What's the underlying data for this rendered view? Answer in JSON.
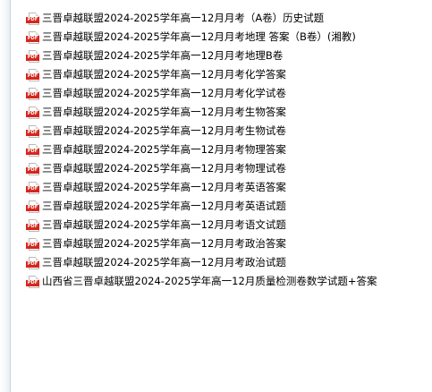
{
  "icons": {
    "file_icon": "pdf-file-icon",
    "file_icon_label": "PDF",
    "accent_color": "#d8261c"
  },
  "files": [
    "三晋卓越联盟2024-2025学年高一12月月考（A卷）历史试题",
    "三晋卓越联盟2024-2025学年高一12月月考地理 答案（B卷）(湘教)",
    "三晋卓越联盟2024-2025学年高一12月月考地理B卷",
    "三晋卓越联盟2024-2025学年高一12月月考化学答案",
    "三晋卓越联盟2024-2025学年高一12月月考化学试卷",
    "三晋卓越联盟2024-2025学年高一12月月考生物答案",
    "三晋卓越联盟2024-2025学年高一12月月考生物试卷",
    "三晋卓越联盟2024-2025学年高一12月月考物理答案",
    "三晋卓越联盟2024-2025学年高一12月月考物理试卷",
    "三晋卓越联盟2024-2025学年高一12月月考英语答案",
    "三晋卓越联盟2024-2025学年高一12月月考英语试题",
    "三晋卓越联盟2024-2025学年高一12月月考语文试题",
    "三晋卓越联盟2024-2025学年高一12月月考政治答案",
    "三晋卓越联盟2024-2025学年高一12月月考政治试题",
    "山西省三晋卓越联盟2024-2025学年高一12月质量检测卷数学试题+答案"
  ]
}
